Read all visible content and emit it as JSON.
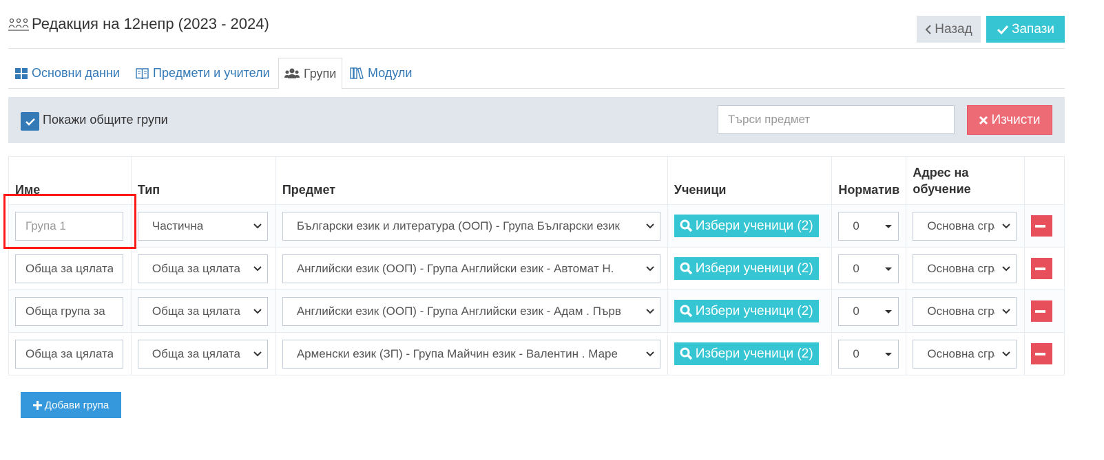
{
  "header": {
    "title": "Редакция на 12непр (2023 - 2024)",
    "back_label": "Назад",
    "save_label": "Запази"
  },
  "tabs": [
    {
      "label": "Основни данни",
      "icon": "grid-icon",
      "active": false
    },
    {
      "label": "Предмети и учители",
      "icon": "book-icon",
      "active": false
    },
    {
      "label": "Групи",
      "icon": "users-icon",
      "active": true
    },
    {
      "label": "Модули",
      "icon": "books-icon",
      "active": false
    }
  ],
  "filter": {
    "show_common_label": "Покажи общите групи",
    "show_common_checked": true,
    "search_placeholder": "Търси предмет",
    "clear_label": "Изчисти"
  },
  "table": {
    "headers": {
      "name": "Име",
      "type": "Тип",
      "subject": "Предмет",
      "students": "Ученици",
      "norm": "Норматив",
      "address": "Адрес на обучение"
    },
    "rows": [
      {
        "name_value": "",
        "name_placeholder": "Група 1",
        "type": "Частична",
        "subject": "Български език и литература (ООП) - Група Български език",
        "students_label": "Избери ученици (2)",
        "norm": "0",
        "address": "Основна сграда"
      },
      {
        "name_value": "Обща за цялата",
        "name_placeholder": "",
        "type": "Обща за цялата",
        "subject": "Английски език (ООП) - Група Английски език - Автомат Н.",
        "students_label": "Избери ученици (2)",
        "norm": "0",
        "address": "Основна сграда"
      },
      {
        "name_value": "Обща група за",
        "name_placeholder": "",
        "type": "Обща за цялата",
        "subject": "Английски език (ООП) - Група Английски език - Адам . Първ",
        "students_label": "Избери ученици (2)",
        "norm": "0",
        "address": "Основна сграда"
      },
      {
        "name_value": "Обща за цялата",
        "name_placeholder": "",
        "type": "Обща за цялата",
        "subject": "Арменски език (ЗП) - Група Майчин език - Валентин . Маре",
        "students_label": "Избери ученици (2)",
        "norm": "0",
        "address": "Основна сграда"
      }
    ]
  },
  "add_group_label": "Добави група",
  "colors": {
    "accent_teal": "#36c6d3",
    "primary_blue": "#3598dc",
    "danger_red": "#e7505a",
    "clear_red": "#ed6b75",
    "filter_bg": "#e1e5ec",
    "link_blue": "#337ab7",
    "highlight_red": "#ff1a1a"
  }
}
